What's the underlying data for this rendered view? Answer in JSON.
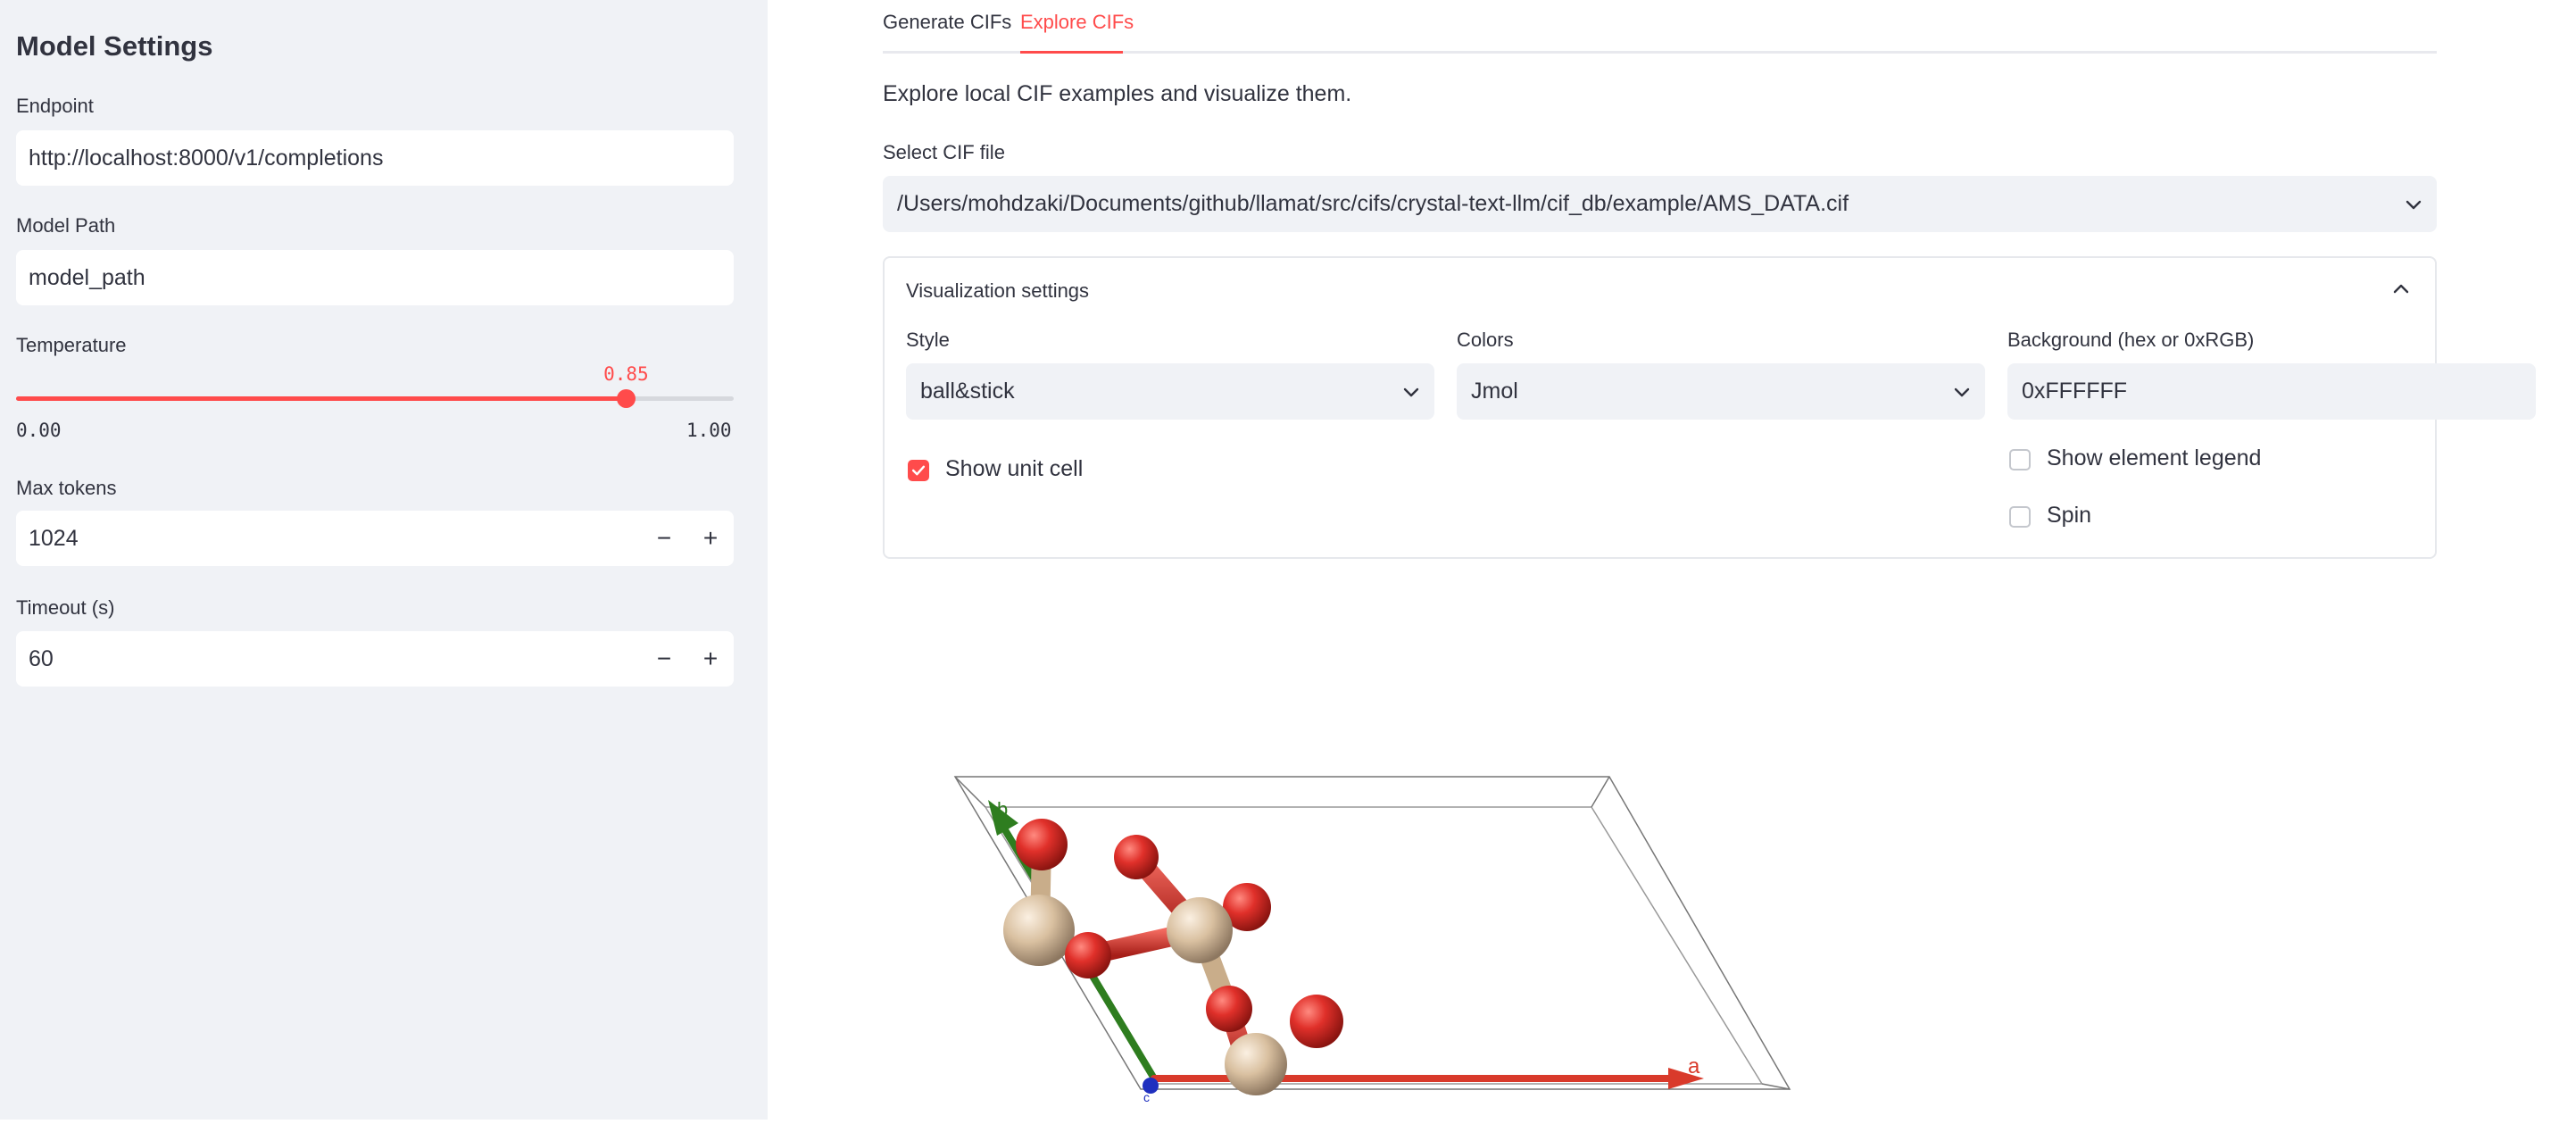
{
  "sidebar": {
    "title": "Model Settings",
    "endpoint": {
      "label": "Endpoint",
      "value": "http://localhost:8000/v1/completions"
    },
    "model_path": {
      "label": "Model Path",
      "value": "model_path"
    },
    "temperature": {
      "label": "Temperature",
      "value": "0.85",
      "fraction": 0.85,
      "min": "0.00",
      "max": "1.00"
    },
    "max_tokens": {
      "label": "Max tokens",
      "value": "1024",
      "minus": "−",
      "plus": "+"
    },
    "timeout": {
      "label": "Timeout (s)",
      "value": "60",
      "minus": "−",
      "plus": "+"
    }
  },
  "tabs": [
    {
      "label": "Generate CIFs",
      "active": false
    },
    {
      "label": "Explore CIFs",
      "active": true
    }
  ],
  "main": {
    "intro": "Explore local CIF examples and visualize them.",
    "file_select": {
      "label": "Select CIF file",
      "value": "/Users/mohdzaki/Documents/github/llamat/src/cifs/crystal-text-llm/cif_db/example/AMS_DATA.cif"
    }
  },
  "viz": {
    "title": "Visualization settings",
    "style": {
      "label": "Style",
      "value": "ball&stick"
    },
    "colors": {
      "label": "Colors",
      "value": "Jmol"
    },
    "background": {
      "label": "Background (hex or 0xRGB)",
      "value": "0xFFFFFF"
    },
    "show_unit_cell": {
      "label": "Show unit cell",
      "checked": true
    },
    "show_element_legend": {
      "label": "Show element legend",
      "checked": false
    },
    "spin": {
      "label": "Spin",
      "checked": false
    }
  },
  "structure": {
    "axis_labels": {
      "a": "a",
      "b": "b",
      "c": "c"
    }
  },
  "colors": {
    "accent": "#ff4b4b",
    "sidebar_bg": "#f0f2f6",
    "oxygen": "#e0302a",
    "metal": "#d9c0a0",
    "axis_a": "#d93a2b",
    "axis_b": "#2e7d1f",
    "axis_c": "#1f2fbf"
  }
}
